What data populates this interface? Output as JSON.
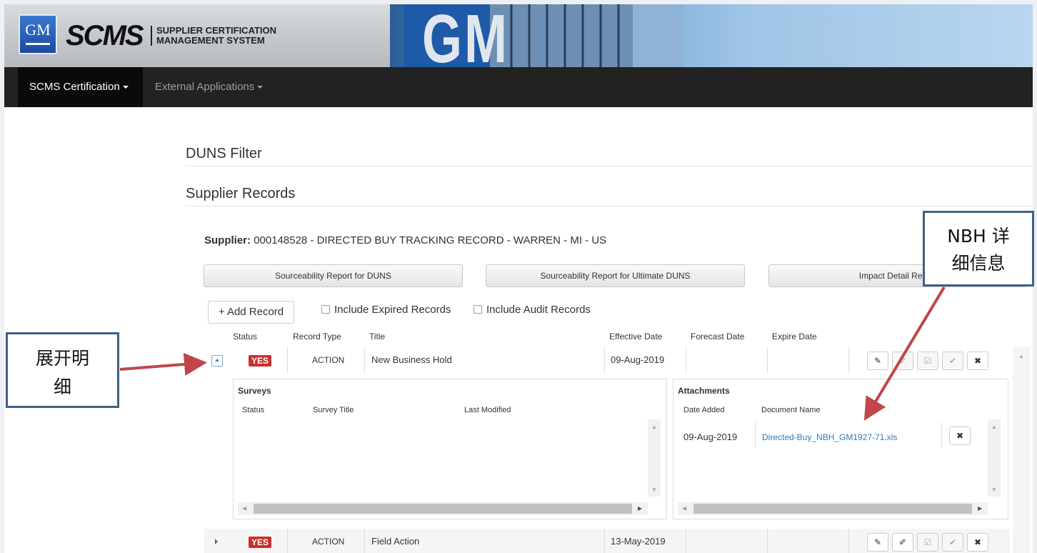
{
  "banner": {
    "gm_logo": "GM",
    "scms_logo": "SCMS",
    "subtitle_line1": "SUPPLIER CERTIFICATION",
    "subtitle_line2": "MANAGEMENT SYSTEM",
    "building_text": "GM"
  },
  "nav": {
    "items": [
      {
        "label": "SCMS Certification"
      },
      {
        "label": "External Applications"
      }
    ]
  },
  "sections": {
    "duns_filter": "DUNS Filter",
    "supplier_records": "Supplier Records"
  },
  "supplier": {
    "label": "Supplier:",
    "value": "000148528 - DIRECTED BUY TRACKING RECORD - WARREN - MI - US"
  },
  "report_buttons": [
    {
      "label": "Sourceability Report for DUNS"
    },
    {
      "label": "Sourceability Report for Ultimate DUNS"
    },
    {
      "label": "Impact Detail Report"
    }
  ],
  "toolbar": {
    "add_record": "Add Record",
    "include_expired": "Include Expired Records",
    "include_audit": "Include Audit Records"
  },
  "columns": [
    "Status",
    "Record Type",
    "Title",
    "Effective Date",
    "Forecast Date",
    "Expire Date"
  ],
  "records": [
    {
      "status": "YES",
      "type": "ACTION",
      "title": "New Business Hold",
      "effective": "09-Aug-2019",
      "forecast": "",
      "expire": ""
    },
    {
      "status": "YES",
      "type": "ACTION",
      "title": "Field Action",
      "effective": "13-May-2019",
      "forecast": "",
      "expire": ""
    }
  ],
  "surveys": {
    "title": "Surveys",
    "columns": [
      "Status",
      "Survey Title",
      "Last Modified"
    ]
  },
  "attachments": {
    "title": "Attachments",
    "columns": [
      "Date Added",
      "Document Name"
    ],
    "rows": [
      {
        "date": "09-Aug-2019",
        "name": "Directed-Buy_NBH_GM1927-71.xls"
      }
    ]
  },
  "annotations": {
    "left_callout_line1": "展开明",
    "left_callout_line2": "细",
    "right_callout_line1": "NBH 详",
    "right_callout_line2": "细信息"
  },
  "colors": {
    "navbar": "#222222",
    "status_yes": "#c9302c",
    "link": "#337ab7",
    "callout_border": "#3f6085",
    "arrow": "#c0464a"
  },
  "icons": {
    "edit": "pencil-icon",
    "attach": "paperclip-icon",
    "review": "checkbox-icon",
    "approve": "check-icon",
    "delete": "close-icon"
  }
}
